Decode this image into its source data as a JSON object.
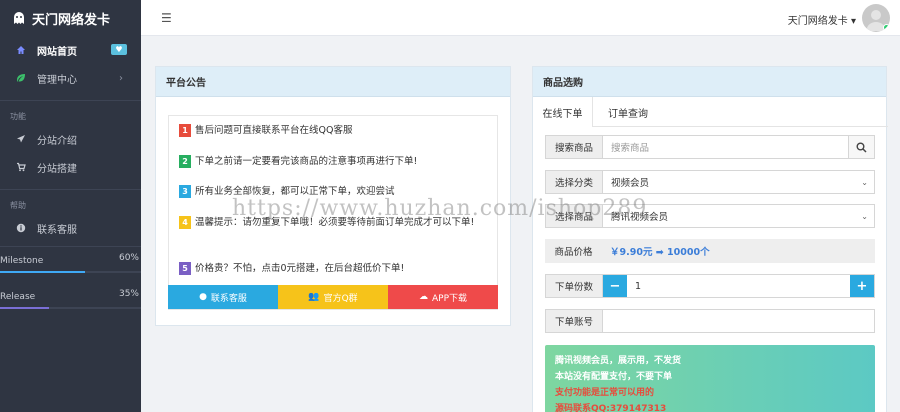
{
  "sidebar": {
    "brand": "天门网络发卡",
    "items": [
      {
        "label": "网站首页",
        "icon": "home-icon"
      },
      {
        "label": "管理中心",
        "icon": "leaf-icon"
      }
    ],
    "section_func": "功能",
    "func_items": [
      {
        "label": "分站介绍",
        "icon": "send-icon"
      },
      {
        "label": "分站搭建",
        "icon": "cart-icon"
      }
    ],
    "section_help": "帮助",
    "help_items": [
      {
        "label": "联系客服",
        "icon": "info-icon"
      }
    ],
    "progress": [
      {
        "label": "Milestone",
        "percent_label": "60%",
        "value": 0.6
      },
      {
        "label": "Release",
        "percent_label": "35%",
        "value": 0.35
      }
    ]
  },
  "topbar": {
    "user_name": "天门网络发卡 ▾"
  },
  "notice": {
    "title": "平台公告",
    "items": [
      {
        "num": "1",
        "color": "#e74c3c",
        "text": "售后问题可直接联系平台在线QQ客服"
      },
      {
        "num": "2",
        "color": "#27ae60",
        "text": "下单之前请一定要看完该商品的注意事项再进行下单!"
      },
      {
        "num": "3",
        "color": "#2aa9e0",
        "text": "所有业务全部恢复，都可以正常下单，欢迎尝试"
      },
      {
        "num": "4",
        "color": "#f6c31a",
        "text": "温馨提示：请勿重复下单哦！必须要等待前面订单完成才可以下单!"
      },
      {
        "num": "5",
        "color": "#7a5fc4",
        "text": "价格贵？不怕，点击0元搭建，在后台超低价下单!"
      }
    ],
    "buttons": {
      "cs": "联系客服",
      "qq": "官方Q群",
      "app": "APP下载"
    }
  },
  "shop": {
    "title": "商品选购",
    "tabs": [
      "在线下单",
      "订单查询"
    ],
    "search_label": "搜索商品",
    "search_placeholder": "搜索商品",
    "category_label": "选择分类",
    "category_value": "视频会员",
    "product_label": "选择商品",
    "product_value": "腾讯视频会员",
    "price_label": "商品价格",
    "price_value": "￥9.90元 ➡ 10000个",
    "qty_label": "下单份数",
    "qty_value": "1",
    "account_label": "下单账号",
    "promo_lines": [
      {
        "text": "腾讯视频会员，展示用，不发货",
        "style": "w"
      },
      {
        "text": "本站没有配置支付，不要下单",
        "style": "w"
      },
      {
        "text": "支付功能是正常可以用的",
        "style": "r"
      },
      {
        "text": "源码联系QQ:379147313",
        "style": "r"
      }
    ]
  },
  "watermark": "https://www.huzhan.com/ishop289"
}
